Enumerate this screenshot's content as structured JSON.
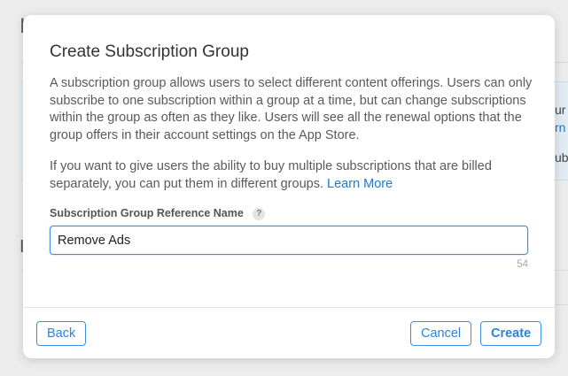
{
  "background": {
    "heading_char_1": "I",
    "heading_char_2": "I",
    "right_line_1": "ur",
    "right_line_2": "rn",
    "right_line_3": "ubr"
  },
  "dialog": {
    "title": "Create Subscription Group",
    "paragraph_1": "A subscription group allows users to select different content offerings. Users can only subscribe to one subscription within a group at a time, but can change subscriptions within the group as often as they like. Users will see all the renewal options that the group offers in their account settings on the App Store.",
    "paragraph_2": "If you want to give users the ability to buy multiple subscriptions that are billed separately, you can put them in different groups.",
    "learn_more": "Learn More",
    "field_label": "Subscription Group Reference Name",
    "help_glyph": "?",
    "field_value": "Remove Ads",
    "char_count": "54",
    "buttons": {
      "back": "Back",
      "cancel": "Cancel",
      "create": "Create"
    }
  },
  "colors": {
    "accent": "#1a7bd3",
    "input_focus_border": "#3b8ce3"
  }
}
